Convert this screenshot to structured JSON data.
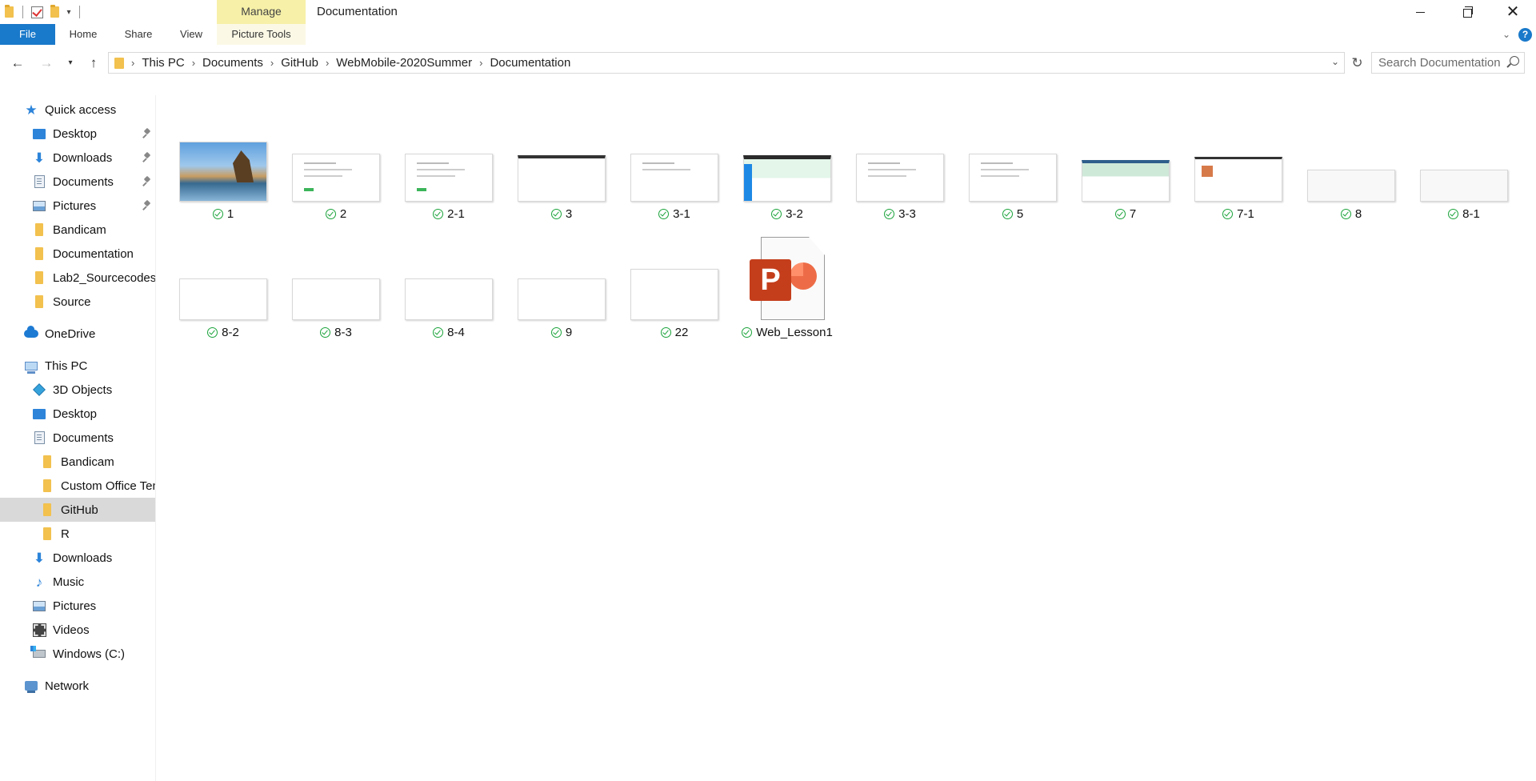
{
  "window": {
    "title": "Documentation",
    "manage_label": "Manage"
  },
  "ribbon": {
    "tabs": {
      "file": "File",
      "home": "Home",
      "share": "Share",
      "view": "View",
      "picture_tools": "Picture Tools"
    },
    "help_label": "?"
  },
  "address": {
    "crumbs": [
      "This PC",
      "Documents",
      "GitHub",
      "WebMobile-2020Summer",
      "Documentation"
    ]
  },
  "search": {
    "placeholder": "Search Documentation"
  },
  "nav": {
    "quick_access": "Quick access",
    "quick_items": [
      {
        "label": "Desktop",
        "icon": "desktop-icon",
        "pinned": true
      },
      {
        "label": "Downloads",
        "icon": "downloads-icon",
        "pinned": true
      },
      {
        "label": "Documents",
        "icon": "documents-icon",
        "pinned": true
      },
      {
        "label": "Pictures",
        "icon": "pictures-icon",
        "pinned": true
      },
      {
        "label": "Bandicam",
        "icon": "folder-icon",
        "pinned": false
      },
      {
        "label": "Documentation",
        "icon": "folder-icon",
        "pinned": false
      },
      {
        "label": "Lab2_Sourcecodes",
        "icon": "folder-icon",
        "pinned": false
      },
      {
        "label": "Source",
        "icon": "folder-icon",
        "pinned": false
      }
    ],
    "onedrive": "OneDrive",
    "this_pc": "This PC",
    "pc_items": [
      {
        "label": "3D Objects",
        "icon": "3d-objects-icon"
      },
      {
        "label": "Desktop",
        "icon": "desktop-icon"
      },
      {
        "label": "Documents",
        "icon": "documents-icon"
      },
      {
        "label": "Bandicam",
        "icon": "folder-icon"
      },
      {
        "label": "Custom Office Ten",
        "icon": "folder-icon"
      },
      {
        "label": "GitHub",
        "icon": "folder-icon",
        "selected": true
      },
      {
        "label": "R",
        "icon": "folder-icon"
      },
      {
        "label": "Downloads",
        "icon": "downloads-icon"
      },
      {
        "label": "Music",
        "icon": "music-icon"
      },
      {
        "label": "Pictures",
        "icon": "pictures-icon"
      },
      {
        "label": "Videos",
        "icon": "videos-icon"
      },
      {
        "label": "Windows (C:)",
        "icon": "drive-icon"
      }
    ],
    "network": "Network"
  },
  "files": [
    {
      "name": "1",
      "thumb": "photo"
    },
    {
      "name": "2",
      "thumb": "doc"
    },
    {
      "name": "2-1",
      "thumb": "doc"
    },
    {
      "name": "3",
      "thumb": "dark"
    },
    {
      "name": "3-1",
      "thumb": "doc"
    },
    {
      "name": "3-2",
      "thumb": "blue"
    },
    {
      "name": "3-3",
      "thumb": "doc"
    },
    {
      "name": "5",
      "thumb": "doc"
    },
    {
      "name": "7",
      "thumb": "green"
    },
    {
      "name": "7-1",
      "thumb": "red"
    },
    {
      "name": "8",
      "thumb": "light"
    },
    {
      "name": "8-1",
      "thumb": "light"
    },
    {
      "name": "8-2",
      "thumb": "tall"
    },
    {
      "name": "8-3",
      "thumb": "tall"
    },
    {
      "name": "8-4",
      "thumb": "tall"
    },
    {
      "name": "9",
      "thumb": "tall"
    },
    {
      "name": "22",
      "thumb": "list"
    },
    {
      "name": "Web_Lesson1",
      "thumb": "ppt"
    }
  ],
  "colors": {
    "accent": "#1979ca",
    "manage_tab": "#f6f0a8",
    "sync_ok": "#1aa33a",
    "selection": "#d9d9d9"
  }
}
